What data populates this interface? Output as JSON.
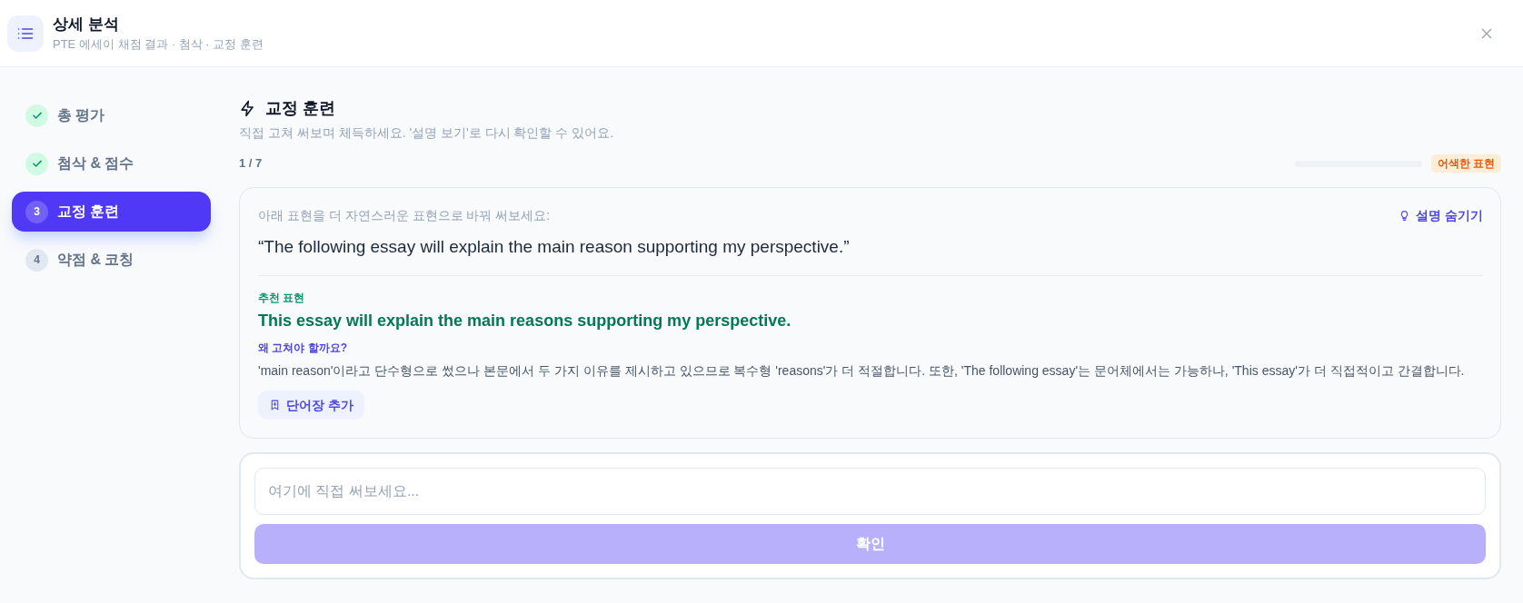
{
  "header": {
    "title": "상세 분석",
    "subtitle": "PTE 에세이 채점 결과 · 첨삭 · 교정 훈련"
  },
  "steps": [
    {
      "label": "총 평가",
      "completed": true,
      "selected": false
    },
    {
      "label": "첨삭 & 점수",
      "completed": true,
      "selected": false
    },
    {
      "label": "교정 훈련",
      "number": "3",
      "completed": false,
      "selected": true
    },
    {
      "label": "약점 & 코칭",
      "number": "4",
      "completed": false,
      "selected": false
    }
  ],
  "section": {
    "title": "교정 훈련",
    "description": "직접 고쳐 써보며 체득하세요. '설명 보기'로 다시 확인할 수 있어요.",
    "counter": "1 / 7",
    "progress": {
      "level": 0
    },
    "tag": "어색한 표현"
  },
  "exercise": {
    "instruction": "아래 표현을 더 자연스러운 표현으로 바꿔 써보세요:",
    "toggle_label": "설명 숨기기",
    "explanation_open": true,
    "original": "“The following essay will explain the main reason supporting my perspective.”",
    "suggestion_label": "추천 표현",
    "suggestion": "This essay will explain the main reasons supporting my perspective.",
    "why_label": "왜 고쳐야 할까요?",
    "why": "'main reason'이라고 단수형으로 썼으나 본문에서 두 가지 이유를 제시하고 있으므로 복수형 'reasons'가 더 적절합니다. 또한, 'The following essay'는 문어체에서는 가능하나, 'This essay'가 더 직접적이고 간결합니다.",
    "vocab_button": "단어장 추가"
  },
  "answer": {
    "placeholder": "여기에 직접 써보세요...",
    "submit": {
      "label": "확인",
      "disabled": true
    }
  }
}
